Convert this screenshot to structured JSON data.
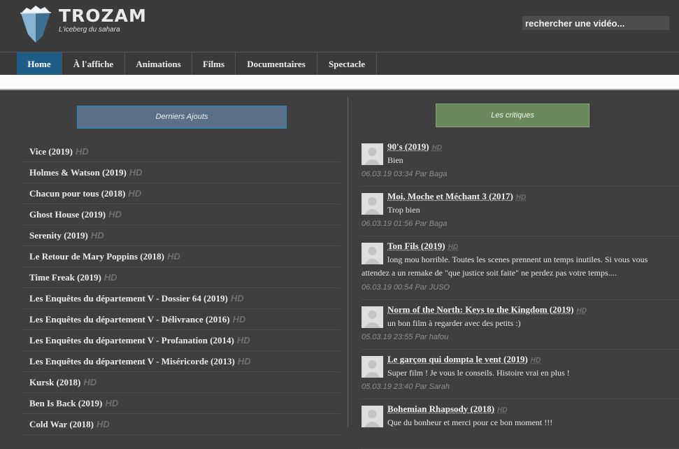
{
  "site": {
    "title": "TROZAM",
    "tagline": "L'iceberg du sahara",
    "search_placeholder": "rechercher une vidéo..."
  },
  "nav": {
    "items": [
      {
        "label": "Home",
        "active": true
      },
      {
        "label": "À l'affiche"
      },
      {
        "label": "Animations"
      },
      {
        "label": "Films"
      },
      {
        "label": "Documentaires"
      },
      {
        "label": "Spectacle"
      }
    ]
  },
  "latest": {
    "header": "Derniers Ajouts",
    "items": [
      {
        "title": "Vice (2019)",
        "badge": "HD"
      },
      {
        "title": "Holmes & Watson (2019)",
        "badge": "HD"
      },
      {
        "title": "Chacun pour tous (2018)",
        "badge": "HD"
      },
      {
        "title": "Ghost House (2019)",
        "badge": "HD"
      },
      {
        "title": "Serenity (2019)",
        "badge": "HD"
      },
      {
        "title": "Le Retour de Mary Poppins (2018)",
        "badge": "HD"
      },
      {
        "title": "Time Freak (2019)",
        "badge": "HD"
      },
      {
        "title": "Les Enquêtes du département V - Dossier 64 (2019)",
        "badge": "HD"
      },
      {
        "title": "Les Enquêtes du département V - Délivrance (2016)",
        "badge": "HD"
      },
      {
        "title": "Les Enquêtes du département V - Profanation (2014)",
        "badge": "HD"
      },
      {
        "title": "Les Enquêtes du département V - Miséricorde (2013)",
        "badge": "HD"
      },
      {
        "title": "Kursk (2018)",
        "badge": "HD"
      },
      {
        "title": "Ben Is Back (2019)",
        "badge": "HD"
      },
      {
        "title": "Cold War (2018)",
        "badge": "HD"
      }
    ]
  },
  "reviews": {
    "header": "Les critiques",
    "items": [
      {
        "title": "90's (2019)",
        "badge": "HD",
        "text": "Bien",
        "meta": "06.03.19 03:34 Par Baga"
      },
      {
        "title": "Moi, Moche et Méchant 3 (2017)",
        "badge": "HD",
        "text": "Trop bien",
        "meta": "06.03.19 01:56 Par Baga"
      },
      {
        "title": "Ton Fils (2019)",
        "badge": "HD",
        "text": "long mou horrible. Toutes les scenes prennent un temps inutiles. Si vous vous attendez a un remake de \"que justice soit faite\" ne perdez pas votre temps....",
        "meta": "06.03.19 00:54 Par JUSO",
        "long": true
      },
      {
        "title": "Norm of the North: Keys to the Kingdom (2019)",
        "badge": "HD",
        "text": "un bon film à regarder avec des petits :)",
        "meta": "05.03.19 23:55 Par hafou"
      },
      {
        "title": "Le garçon qui dompta le vent (2019)",
        "badge": "HD",
        "text": "Super film ! Je vous le conseils. Histoire vrai en plus !",
        "meta": "05.03.19 23:40 Par Sarah"
      },
      {
        "title": "Bohemian Rhapsody (2018)",
        "badge": "HD",
        "text": "Que du bonheur et merci pour ce bon moment !!!",
        "meta": ""
      }
    ]
  },
  "colors": {
    "background": "#3f3f3f",
    "nav_active": "#1e5e86",
    "latest_button": "#5b6f86",
    "reviews_button": "#6a8a5e",
    "badge": "#6f6f6f"
  },
  "icons": {
    "logo": "iceberg-logo-icon",
    "avatar": "user-avatar-placeholder-icon"
  }
}
